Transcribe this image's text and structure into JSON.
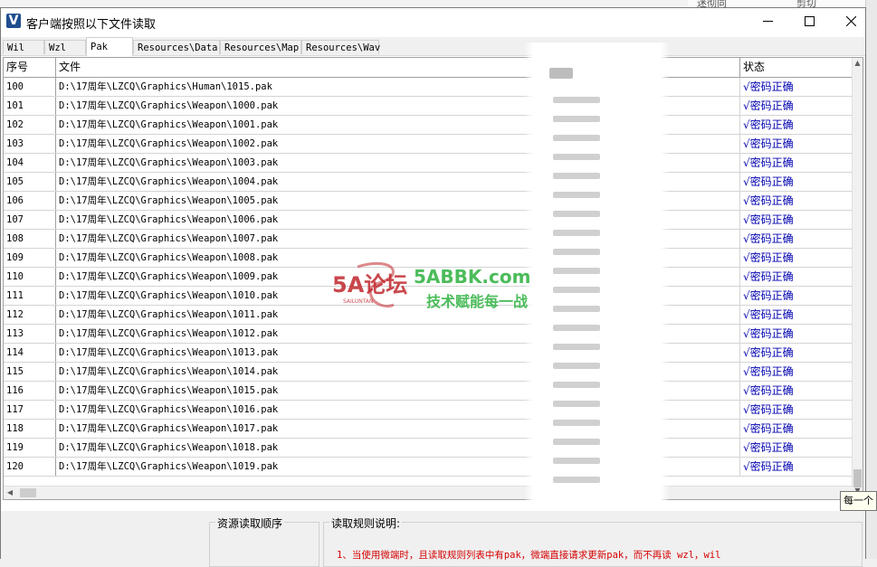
{
  "window": {
    "title": "客户端按照以下文件读取",
    "app_icon_letter": "V"
  },
  "background": {
    "top_snippet_1": "迷彻同",
    "top_snippet_2": "剪切"
  },
  "tabs": [
    "Wil",
    "Wzl",
    "Pak",
    "Resources\\Data",
    "Resources\\Map",
    "Resources\\Wav"
  ],
  "active_tab": "Pak",
  "grid": {
    "headers": {
      "index": "序号",
      "file": "文件",
      "status": "状态"
    },
    "rows": [
      {
        "index": "100",
        "file": "D:\\17周年\\LZCQ\\Graphics\\Human\\1015.pak",
        "status": "√密码正确"
      },
      {
        "index": "101",
        "file": "D:\\17周年\\LZCQ\\Graphics\\Weapon\\1000.pak",
        "status": "√密码正确"
      },
      {
        "index": "102",
        "file": "D:\\17周年\\LZCQ\\Graphics\\Weapon\\1001.pak",
        "status": "√密码正确"
      },
      {
        "index": "103",
        "file": "D:\\17周年\\LZCQ\\Graphics\\Weapon\\1002.pak",
        "status": "√密码正确"
      },
      {
        "index": "104",
        "file": "D:\\17周年\\LZCQ\\Graphics\\Weapon\\1003.pak",
        "status": "√密码正确"
      },
      {
        "index": "105",
        "file": "D:\\17周年\\LZCQ\\Graphics\\Weapon\\1004.pak",
        "status": "√密码正确"
      },
      {
        "index": "106",
        "file": "D:\\17周年\\LZCQ\\Graphics\\Weapon\\1005.pak",
        "status": "√密码正确"
      },
      {
        "index": "107",
        "file": "D:\\17周年\\LZCQ\\Graphics\\Weapon\\1006.pak",
        "status": "√密码正确"
      },
      {
        "index": "108",
        "file": "D:\\17周年\\LZCQ\\Graphics\\Weapon\\1007.pak",
        "status": "√密码正确"
      },
      {
        "index": "109",
        "file": "D:\\17周年\\LZCQ\\Graphics\\Weapon\\1008.pak",
        "status": "√密码正确"
      },
      {
        "index": "110",
        "file": "D:\\17周年\\LZCQ\\Graphics\\Weapon\\1009.pak",
        "status": "√密码正确"
      },
      {
        "index": "111",
        "file": "D:\\17周年\\LZCQ\\Graphics\\Weapon\\1010.pak",
        "status": "√密码正确"
      },
      {
        "index": "112",
        "file": "D:\\17周年\\LZCQ\\Graphics\\Weapon\\1011.pak",
        "status": "√密码正确"
      },
      {
        "index": "113",
        "file": "D:\\17周年\\LZCQ\\Graphics\\Weapon\\1012.pak",
        "status": "√密码正确"
      },
      {
        "index": "114",
        "file": "D:\\17周年\\LZCQ\\Graphics\\Weapon\\1013.pak",
        "status": "√密码正确"
      },
      {
        "index": "115",
        "file": "D:\\17周年\\LZCQ\\Graphics\\Weapon\\1014.pak",
        "status": "√密码正确"
      },
      {
        "index": "116",
        "file": "D:\\17周年\\LZCQ\\Graphics\\Weapon\\1015.pak",
        "status": "√密码正确"
      },
      {
        "index": "117",
        "file": "D:\\17周年\\LZCQ\\Graphics\\Weapon\\1016.pak",
        "status": "√密码正确"
      },
      {
        "index": "118",
        "file": "D:\\17周年\\LZCQ\\Graphics\\Weapon\\1017.pak",
        "status": "√密码正确"
      },
      {
        "index": "119",
        "file": "D:\\17周年\\LZCQ\\Graphics\\Weapon\\1018.pak",
        "status": "√密码正确"
      },
      {
        "index": "120",
        "file": "D:\\17周年\\LZCQ\\Graphics\\Weapon\\1019.pak",
        "status": "√密码正确"
      }
    ]
  },
  "tooltip": "每一个",
  "bottom": {
    "order_label": "资源读取顺序",
    "rules_label": "读取规则说明:",
    "rule_1": "1、当使用微端时，且读取规则列表中有pak，微端直接请求更新pak，而不再读 wzl，wil"
  },
  "watermark": {
    "site_logo": "5A论坛",
    "site_sub": "SAILUNTAN",
    "domain": "5ABBK.com",
    "slogan": "技术赋能每一战"
  },
  "colors": {
    "status_text": "#0000b0",
    "rule_text": "#d40000",
    "watermark_green": "#39b54a",
    "watermark_red": "#c0282d"
  }
}
